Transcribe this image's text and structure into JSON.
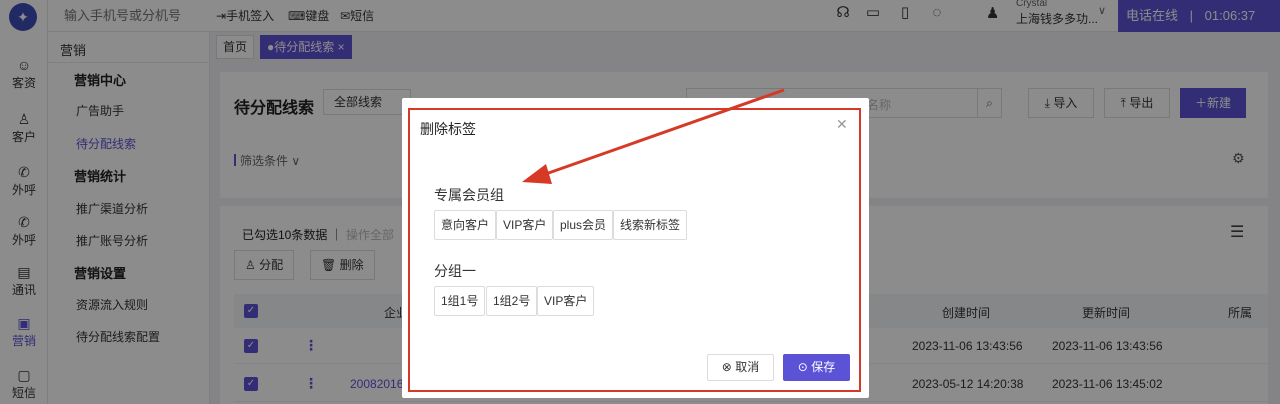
{
  "rail": {
    "items": [
      {
        "label": "客资",
        "icon": "contacts-icon"
      },
      {
        "label": "客户",
        "icon": "customer-icon"
      },
      {
        "label": "外呼",
        "icon": "outbound-call-icon"
      },
      {
        "label": "外呼",
        "icon": "callback-icon"
      },
      {
        "label": "通讯",
        "icon": "address-book-icon"
      },
      {
        "label": "营销",
        "icon": "marketing-icon"
      },
      {
        "label": "短信",
        "icon": "sms-icon"
      }
    ]
  },
  "topbar": {
    "dial_placeholder": "输入手机号或分机号",
    "phone_checkin": "手机签入",
    "keypad": "键盘",
    "sms": "短信",
    "user_name": "Crystal",
    "user_company": "上海钱多多功...",
    "phone_status": "电话在线",
    "timer": "01:06:37"
  },
  "subnav": {
    "title": "营销",
    "groups": [
      {
        "label": "营销中心",
        "items": [
          "广告助手",
          "待分配线索"
        ]
      },
      {
        "label": "营销统计",
        "items": [
          "推广渠道分析",
          "推广账号分析"
        ]
      },
      {
        "label": "营销设置",
        "items": [
          "资源流入规则",
          "待分配线索配置"
        ]
      }
    ]
  },
  "tabs": [
    {
      "label": "首页"
    },
    {
      "label": "●待分配线索 ×"
    }
  ],
  "page": {
    "title": "待分配线索",
    "scope": "全部线索",
    "search_placeholder": "名称",
    "import": "导入",
    "export": "导出",
    "new": "新建",
    "filter": "筛选条件"
  },
  "list": {
    "selected": "已勾选10条数据",
    "select_all": "操作全部",
    "actions": [
      "分配",
      "删除"
    ],
    "columns": [
      "企业",
      "创建时间",
      "更新时间",
      "所属"
    ],
    "rows": [
      {
        "company": "",
        "created": "2023-11-06 13:43:56",
        "updated": "2023-11-06 13:43:56"
      },
      {
        "company": "20082016",
        "created": "2023-05-12 14:20:38",
        "updated": "2023-11-06 13:45:02"
      }
    ]
  },
  "modal": {
    "title": "删除标签",
    "groups": [
      {
        "title": "专属会员组",
        "tags": [
          "意向客户",
          "VIP客户",
          "plus会员",
          "线索新标签"
        ]
      },
      {
        "title": "分组一",
        "tags": [
          "1组1号",
          "1组2号",
          "VIP客户"
        ]
      }
    ],
    "cancel": "取消",
    "save": "保存"
  },
  "colors": {
    "accent": "#5b52d6",
    "annotation": "#d63a26"
  }
}
